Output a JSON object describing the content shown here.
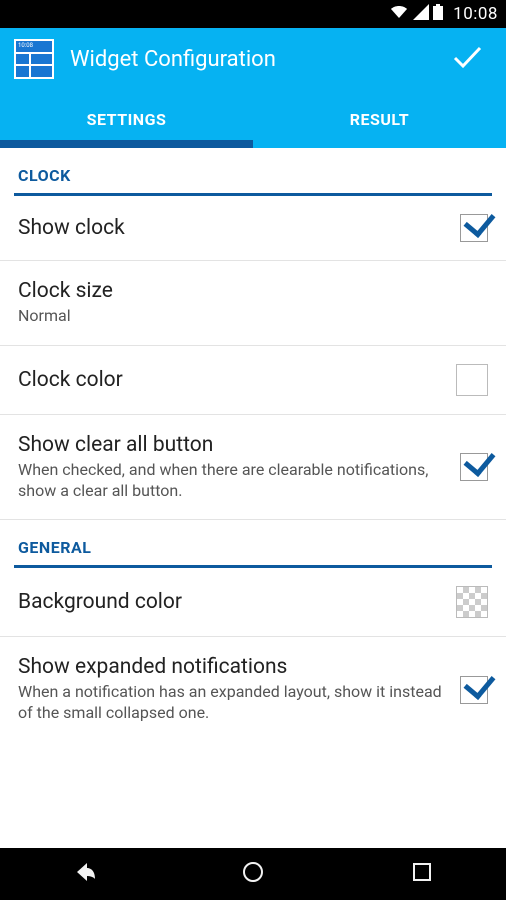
{
  "status": {
    "time": "10:08"
  },
  "header": {
    "title": "Widget Configuration"
  },
  "tabs": {
    "settings": "SETTINGS",
    "result": "RESULT",
    "active": 0
  },
  "sections": {
    "clock": {
      "label": "CLOCK",
      "show_clock": {
        "title": "Show clock",
        "checked": true
      },
      "clock_size": {
        "title": "Clock size",
        "value": "Normal"
      },
      "clock_color": {
        "title": "Clock color",
        "color": "#ffffff"
      },
      "show_clear": {
        "title": "Show clear all button",
        "sub": "When checked, and when there are clearable notifications, show a clear all button.",
        "checked": true
      }
    },
    "general": {
      "label": "GENERAL",
      "bg_color": {
        "title": "Background color",
        "color": "transparent"
      },
      "show_expanded": {
        "title": "Show expanded notifications",
        "sub": "When a notification has an expanded layout, show it instead of the small collapsed one.",
        "checked": true
      }
    }
  }
}
